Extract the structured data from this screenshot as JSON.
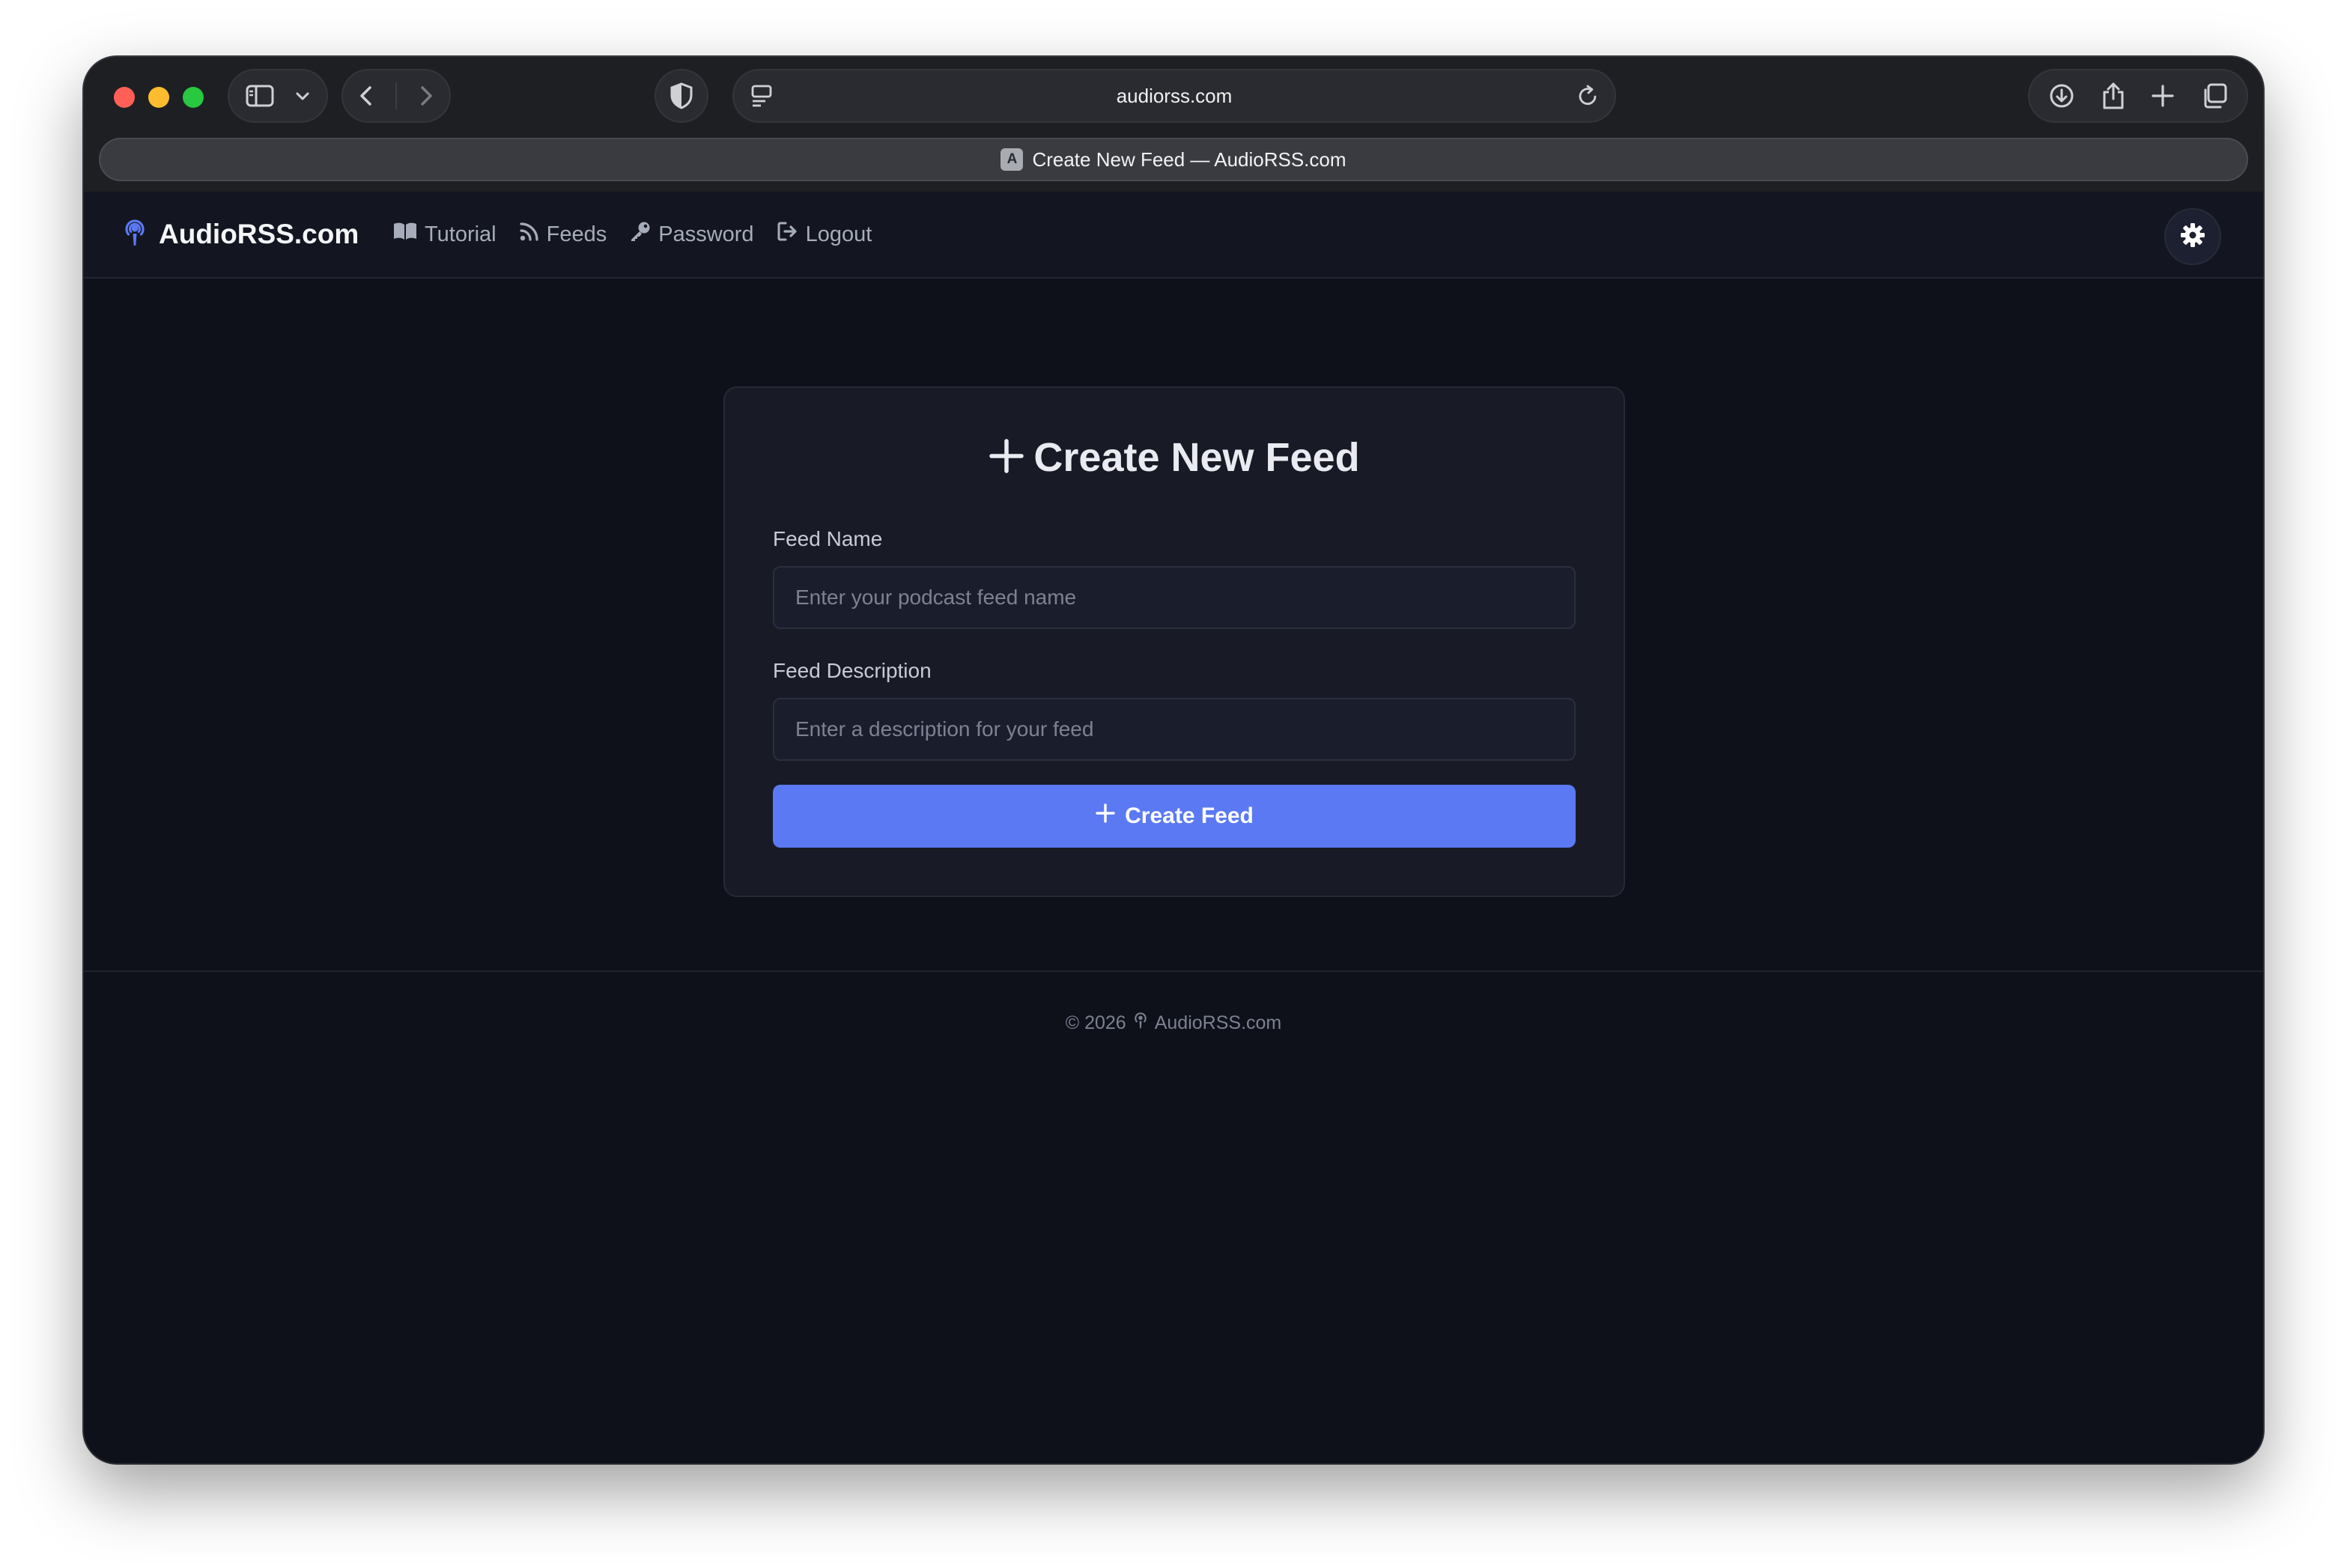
{
  "browser": {
    "url": "audiorss.com",
    "tab_title": "Create New Feed — AudioRSS.com",
    "tab_favicon_letter": "A"
  },
  "site": {
    "brand": "AudioRSS.com",
    "nav": [
      {
        "label": "Tutorial",
        "icon": "book-icon"
      },
      {
        "label": "Feeds",
        "icon": "rss-icon"
      },
      {
        "label": "Password",
        "icon": "key-icon"
      },
      {
        "label": "Logout",
        "icon": "logout-icon"
      }
    ],
    "accent_color": "#5b79f3"
  },
  "form": {
    "title": "Create New Feed",
    "name_label": "Feed Name",
    "name_placeholder": "Enter your podcast feed name",
    "name_value": "",
    "description_label": "Feed Description",
    "description_placeholder": "Enter a description for your feed",
    "description_value": "",
    "submit_label": "Create Feed"
  },
  "footer": {
    "year_text": "© 2026",
    "brand": "AudioRSS.com"
  }
}
